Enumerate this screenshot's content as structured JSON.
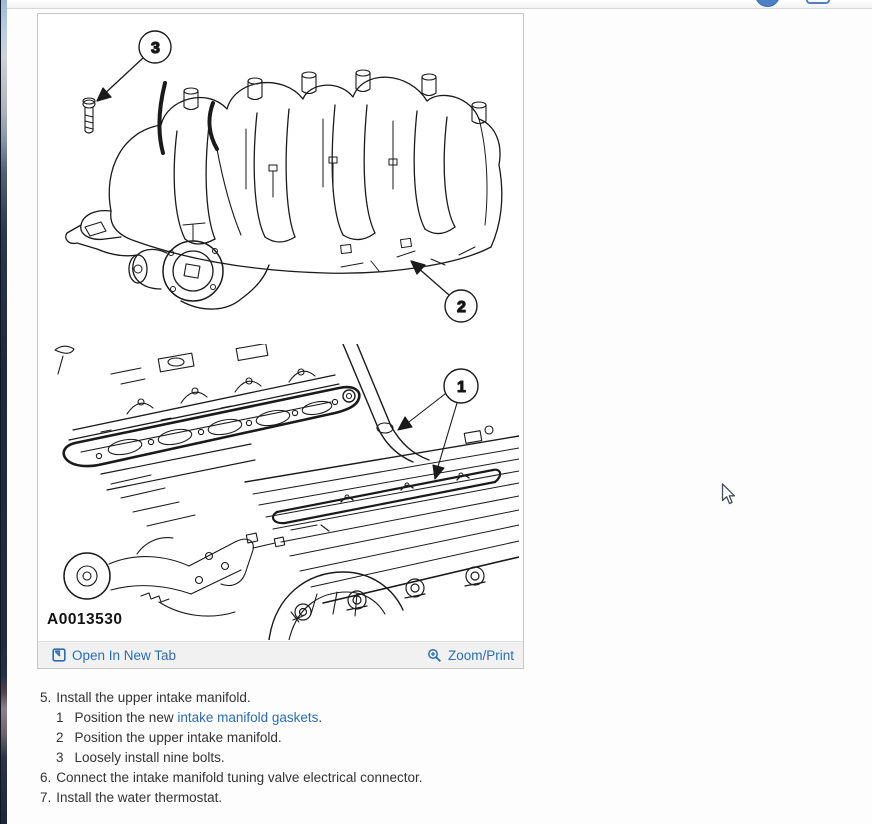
{
  "figure": {
    "image_id": "A0013530",
    "open_in_new_tab_label": "Open In New Tab",
    "zoom_print_label": "Zoom/Print",
    "callout_1": "1",
    "callout_2": "2",
    "callout_3": "3"
  },
  "instructions": {
    "step5": {
      "num": "5.",
      "text": "Install the upper intake manifold."
    },
    "sub1": {
      "num": "1",
      "pre": "Position the new ",
      "link": "intake manifold gaskets",
      "post": "."
    },
    "sub2": {
      "num": "2",
      "text": "Position the upper intake manifold."
    },
    "sub3": {
      "num": "3",
      "text": "Loosely install nine bolts."
    },
    "step6": {
      "num": "6.",
      "text": "Connect the intake manifold tuning valve electrical connector."
    },
    "step7": {
      "num": "7.",
      "text": "Install the water thermostat."
    }
  },
  "colors": {
    "link_blue": "#2a6db5",
    "footer_bg": "#f1f1f1",
    "figure_border": "#c6c6c6",
    "body_text": "#333333",
    "drawing_ink": "#1a1a1a",
    "topbar_icon_blue": "#4d80c4"
  }
}
